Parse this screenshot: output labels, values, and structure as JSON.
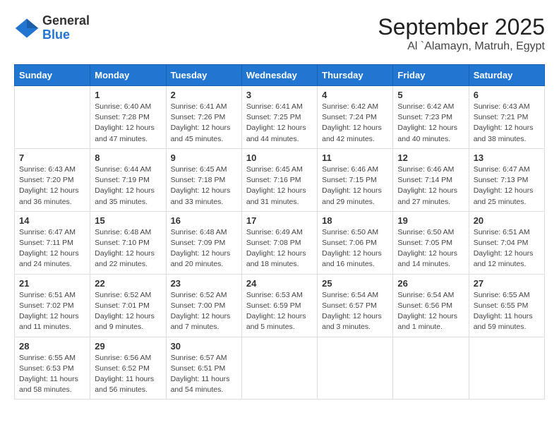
{
  "header": {
    "logo_general": "General",
    "logo_blue": "Blue",
    "title": "September 2025",
    "subtitle": "Al `Alamayn, Matruh, Egypt"
  },
  "days_of_week": [
    "Sunday",
    "Monday",
    "Tuesday",
    "Wednesday",
    "Thursday",
    "Friday",
    "Saturday"
  ],
  "weeks": [
    [
      {
        "day": "",
        "info": ""
      },
      {
        "day": "1",
        "info": "Sunrise: 6:40 AM\nSunset: 7:28 PM\nDaylight: 12 hours and 47 minutes."
      },
      {
        "day": "2",
        "info": "Sunrise: 6:41 AM\nSunset: 7:26 PM\nDaylight: 12 hours and 45 minutes."
      },
      {
        "day": "3",
        "info": "Sunrise: 6:41 AM\nSunset: 7:25 PM\nDaylight: 12 hours and 44 minutes."
      },
      {
        "day": "4",
        "info": "Sunrise: 6:42 AM\nSunset: 7:24 PM\nDaylight: 12 hours and 42 minutes."
      },
      {
        "day": "5",
        "info": "Sunrise: 6:42 AM\nSunset: 7:23 PM\nDaylight: 12 hours and 40 minutes."
      },
      {
        "day": "6",
        "info": "Sunrise: 6:43 AM\nSunset: 7:21 PM\nDaylight: 12 hours and 38 minutes."
      }
    ],
    [
      {
        "day": "7",
        "info": "Sunrise: 6:43 AM\nSunset: 7:20 PM\nDaylight: 12 hours and 36 minutes."
      },
      {
        "day": "8",
        "info": "Sunrise: 6:44 AM\nSunset: 7:19 PM\nDaylight: 12 hours and 35 minutes."
      },
      {
        "day": "9",
        "info": "Sunrise: 6:45 AM\nSunset: 7:18 PM\nDaylight: 12 hours and 33 minutes."
      },
      {
        "day": "10",
        "info": "Sunrise: 6:45 AM\nSunset: 7:16 PM\nDaylight: 12 hours and 31 minutes."
      },
      {
        "day": "11",
        "info": "Sunrise: 6:46 AM\nSunset: 7:15 PM\nDaylight: 12 hours and 29 minutes."
      },
      {
        "day": "12",
        "info": "Sunrise: 6:46 AM\nSunset: 7:14 PM\nDaylight: 12 hours and 27 minutes."
      },
      {
        "day": "13",
        "info": "Sunrise: 6:47 AM\nSunset: 7:13 PM\nDaylight: 12 hours and 25 minutes."
      }
    ],
    [
      {
        "day": "14",
        "info": "Sunrise: 6:47 AM\nSunset: 7:11 PM\nDaylight: 12 hours and 24 minutes."
      },
      {
        "day": "15",
        "info": "Sunrise: 6:48 AM\nSunset: 7:10 PM\nDaylight: 12 hours and 22 minutes."
      },
      {
        "day": "16",
        "info": "Sunrise: 6:48 AM\nSunset: 7:09 PM\nDaylight: 12 hours and 20 minutes."
      },
      {
        "day": "17",
        "info": "Sunrise: 6:49 AM\nSunset: 7:08 PM\nDaylight: 12 hours and 18 minutes."
      },
      {
        "day": "18",
        "info": "Sunrise: 6:50 AM\nSunset: 7:06 PM\nDaylight: 12 hours and 16 minutes."
      },
      {
        "day": "19",
        "info": "Sunrise: 6:50 AM\nSunset: 7:05 PM\nDaylight: 12 hours and 14 minutes."
      },
      {
        "day": "20",
        "info": "Sunrise: 6:51 AM\nSunset: 7:04 PM\nDaylight: 12 hours and 12 minutes."
      }
    ],
    [
      {
        "day": "21",
        "info": "Sunrise: 6:51 AM\nSunset: 7:02 PM\nDaylight: 12 hours and 11 minutes."
      },
      {
        "day": "22",
        "info": "Sunrise: 6:52 AM\nSunset: 7:01 PM\nDaylight: 12 hours and 9 minutes."
      },
      {
        "day": "23",
        "info": "Sunrise: 6:52 AM\nSunset: 7:00 PM\nDaylight: 12 hours and 7 minutes."
      },
      {
        "day": "24",
        "info": "Sunrise: 6:53 AM\nSunset: 6:59 PM\nDaylight: 12 hours and 5 minutes."
      },
      {
        "day": "25",
        "info": "Sunrise: 6:54 AM\nSunset: 6:57 PM\nDaylight: 12 hours and 3 minutes."
      },
      {
        "day": "26",
        "info": "Sunrise: 6:54 AM\nSunset: 6:56 PM\nDaylight: 12 hours and 1 minute."
      },
      {
        "day": "27",
        "info": "Sunrise: 6:55 AM\nSunset: 6:55 PM\nDaylight: 11 hours and 59 minutes."
      }
    ],
    [
      {
        "day": "28",
        "info": "Sunrise: 6:55 AM\nSunset: 6:53 PM\nDaylight: 11 hours and 58 minutes."
      },
      {
        "day": "29",
        "info": "Sunrise: 6:56 AM\nSunset: 6:52 PM\nDaylight: 11 hours and 56 minutes."
      },
      {
        "day": "30",
        "info": "Sunrise: 6:57 AM\nSunset: 6:51 PM\nDaylight: 11 hours and 54 minutes."
      },
      {
        "day": "",
        "info": ""
      },
      {
        "day": "",
        "info": ""
      },
      {
        "day": "",
        "info": ""
      },
      {
        "day": "",
        "info": ""
      }
    ]
  ]
}
